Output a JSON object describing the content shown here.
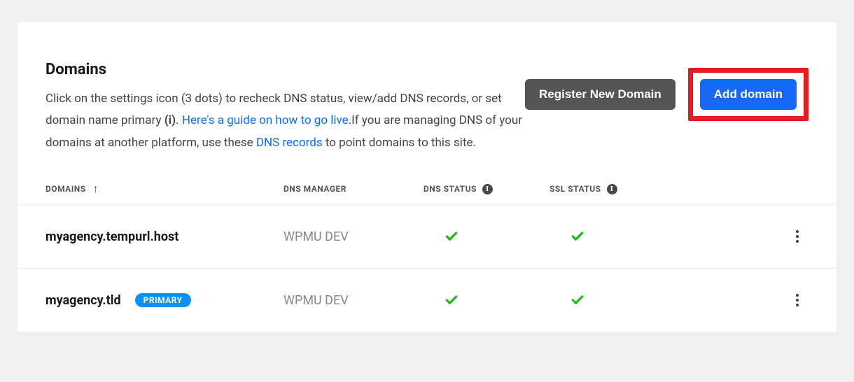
{
  "section": {
    "title": "Domains",
    "description_part1": "Click on the settings icon (3 dots) to recheck DNS status, view/add DNS records, or set domain name primary ",
    "description_bold_i": "(i)",
    "description_part2": ". ",
    "guide_link": "Here's a guide on how to go live",
    "description_part3": ".If you are managing DNS of your domains at another platform, use these ",
    "dns_records_link": "DNS records",
    "description_part4": " to point domains to this site."
  },
  "buttons": {
    "register": "Register New Domain",
    "add": "Add domain"
  },
  "columns": {
    "domains": "DOMAINS",
    "dns_manager": "DNS MANAGER",
    "dns_status": "DNS STATUS",
    "ssl_status": "SSL STATUS"
  },
  "rows": [
    {
      "domain": "myagency.tempurl.host",
      "dns_manager": "WPMU DEV",
      "primary": false,
      "dns_ok": true,
      "ssl_ok": true
    },
    {
      "domain": "myagency.tld",
      "dns_manager": "WPMU DEV",
      "primary": true,
      "primary_label": "PRIMARY",
      "dns_ok": true,
      "ssl_ok": true
    }
  ]
}
